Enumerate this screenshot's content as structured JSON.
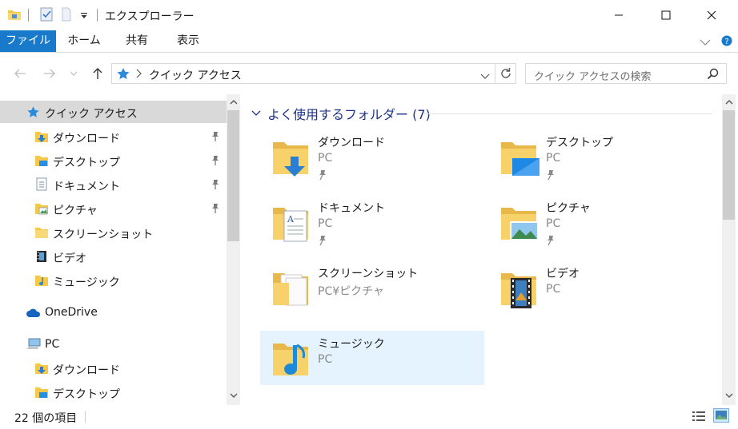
{
  "window": {
    "title": "エクスプローラー"
  },
  "ribbon": {
    "tabs": [
      "ファイル",
      "ホーム",
      "共有",
      "表示"
    ]
  },
  "address": {
    "path": "クイック アクセス",
    "search_placeholder": "クイック アクセスの検索"
  },
  "nav": {
    "quick_access": "クイック アクセス",
    "pinned": [
      {
        "label": "ダウンロード",
        "icon": "download-folder-icon",
        "pinned": true
      },
      {
        "label": "デスクトップ",
        "icon": "desktop-folder-icon",
        "pinned": true
      },
      {
        "label": "ドキュメント",
        "icon": "documents-folder-icon",
        "pinned": true
      },
      {
        "label": "ピクチャ",
        "icon": "pictures-folder-icon",
        "pinned": true
      },
      {
        "label": "スクリーンショット",
        "icon": "folder-icon",
        "pinned": false
      },
      {
        "label": "ビデオ",
        "icon": "videos-folder-icon",
        "pinned": false
      },
      {
        "label": "ミュージック",
        "icon": "music-folder-icon",
        "pinned": false
      }
    ],
    "onedrive": "OneDrive",
    "pc": "PC",
    "pc_children": [
      {
        "label": "ダウンロード",
        "icon": "download-folder-icon"
      },
      {
        "label": "デスクトップ",
        "icon": "desktop-folder-icon"
      }
    ]
  },
  "content": {
    "group_title": "よく使用するフォルダー (7)",
    "folders": [
      {
        "name": "ダウンロード",
        "location": "PC",
        "pinned": true,
        "icon": "download-folder-icon"
      },
      {
        "name": "デスクトップ",
        "location": "PC",
        "pinned": true,
        "icon": "desktop-folder-icon"
      },
      {
        "name": "ドキュメント",
        "location": "PC",
        "pinned": true,
        "icon": "documents-folder-icon"
      },
      {
        "name": "ピクチャ",
        "location": "PC",
        "pinned": true,
        "icon": "pictures-folder-icon"
      },
      {
        "name": "スクリーンショット",
        "location": "PC¥ピクチャ",
        "pinned": false,
        "icon": "screenshots-folder-icon"
      },
      {
        "name": "ビデオ",
        "location": "PC",
        "pinned": false,
        "icon": "videos-folder-icon"
      },
      {
        "name": "ミュージック",
        "location": "PC",
        "pinned": false,
        "icon": "music-folder-icon"
      }
    ]
  },
  "status": {
    "item_count": "22 個の項目"
  },
  "colors": {
    "accent": "#1979ca",
    "folder": "#f7d26a",
    "selected_nav": "#d9d9d9",
    "hover_tile": "#e5f3ff",
    "group_header": "#1e3287"
  }
}
